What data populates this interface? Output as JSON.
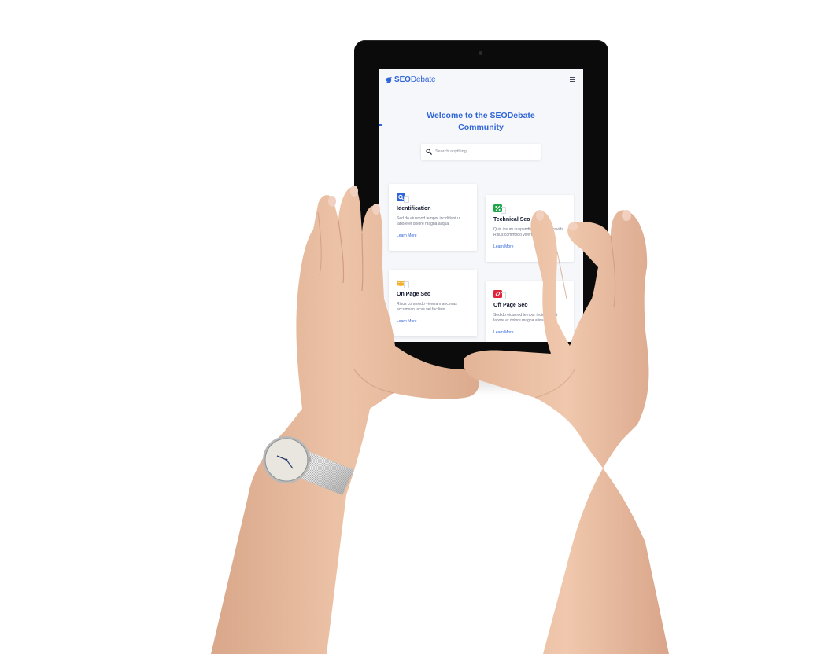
{
  "colors": {
    "accent": "#2f65d8",
    "heading": "#10162b",
    "body_text": "#6e7484",
    "screen_bg": "#f6f7fa",
    "icon_blue": "#2f65d8",
    "icon_green": "#1fa64a",
    "icon_yellow": "#f2b230",
    "icon_red": "#e0243a"
  },
  "nav": {
    "logo_bold": "SEO",
    "logo_regular": "Debate",
    "logo_icon": "bird-logo-icon",
    "menu_icon": "hamburger-menu-icon"
  },
  "hero": {
    "title_line1": "Welcome to the SEODebate",
    "title_line2": "Community"
  },
  "search": {
    "placeholder": "Search anything",
    "icon": "search-icon"
  },
  "cards": [
    {
      "title": "Identification",
      "description": "Sed do eiusmod tempor incididunt ut labore et dolore magna aliqua.",
      "link": "Learn More",
      "icon": "magnifier-icon",
      "icon_color": "#2f65d8"
    },
    {
      "title": "Technical Seo",
      "description": "Quis ipsum suspendisse ultrices gravida. Risus commodo viverra.",
      "link": "Learn More",
      "icon": "percent-icon",
      "icon_color": "#1fa64a"
    },
    {
      "title": "On Page Seo",
      "description": "Risus commodo viverra maecenas accumsan lacus vel facilisis.",
      "link": "Learn More",
      "icon": "open-book-icon",
      "icon_color": "#f2b230"
    },
    {
      "title": "Off Page Seo",
      "description": "Sed do eiusmod tempor incididunt ut labore et dolore magna aliqua.",
      "link": "Learn More",
      "icon": "link-icon",
      "icon_color": "#e0243a"
    }
  ]
}
